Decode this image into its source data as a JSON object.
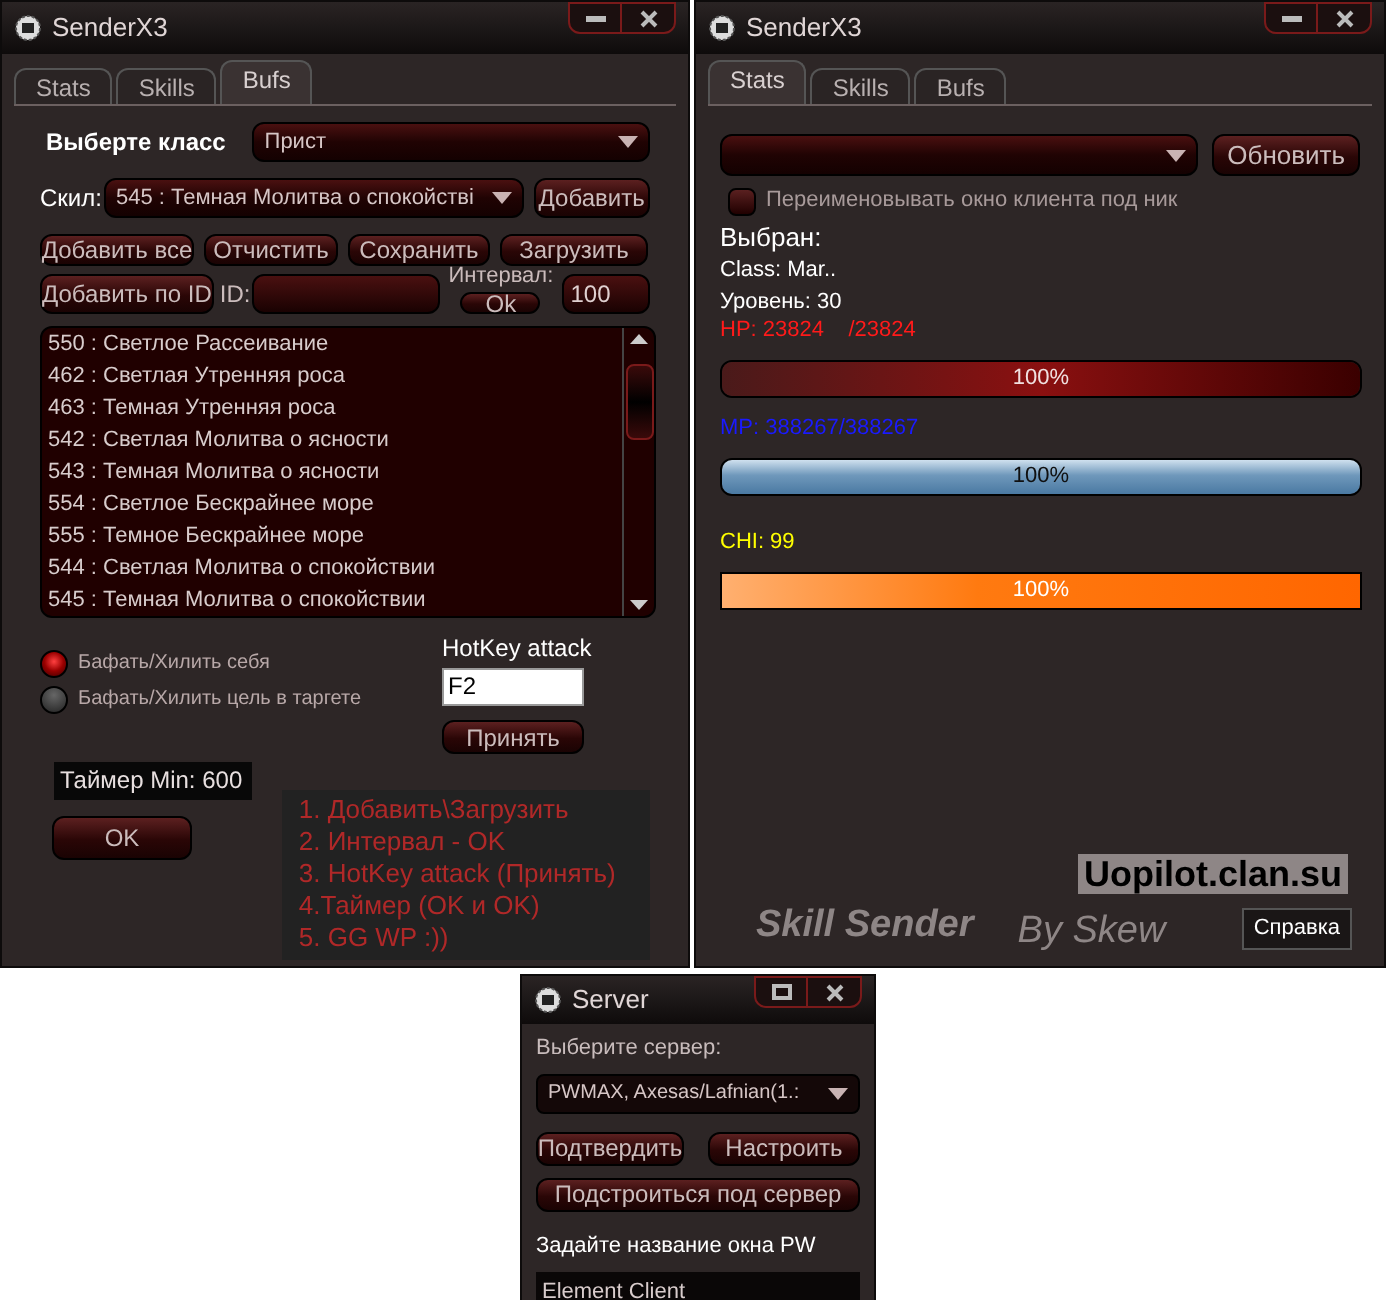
{
  "bufs_window": {
    "title": "SenderX3",
    "tabs": [
      {
        "label": "Stats",
        "selected": false
      },
      {
        "label": "Skills",
        "selected": false
      },
      {
        "label": "Bufs",
        "selected": true
      }
    ],
    "class_label": "Выберте класс",
    "class_value": "Прист",
    "skill_label": "Скил:",
    "skill_value": "545 : Темная Молитва о спокойстві",
    "add_button": "Добавить",
    "action_buttons": [
      "Добавить все",
      "Отчистить",
      "Сохранить",
      "Загрузить"
    ],
    "add_by_id_button": "Добавить по ID",
    "id_label": "ID:",
    "interval_label": "Интервал:",
    "interval_ok": "Ok",
    "interval_value": "100",
    "skills": [
      "550 : Светлое Рассеивание",
      "462 : Светлая Утренняя роса",
      "463 : Темная Утренняя роса",
      "542 : Светлая Молитва о ясности",
      "543 : Темная Молитва о ясности",
      "554 : Светлое Бескрайнее море",
      "555 : Темное Бескрайнее море",
      "544 : Светлая Молитва о спокойствии",
      "545 : Темная Молитва о спокойствии"
    ],
    "targets": [
      {
        "label": "Бафать/Хилить себя",
        "selected": true
      },
      {
        "label": "Бафать/Хилить цель в таргете",
        "selected": false
      }
    ],
    "hotkey_label": "HotKey attack",
    "hotkey_value": "F2",
    "apply_button": "Принять",
    "timer_value": "Таймер Min: 600",
    "ok_button": "OK",
    "instructions": [
      "1. Добавить\\Загрузить",
      "2. Интервал - OK",
      "3. HotKey attack (Принять)",
      "4.Таймер (OK и OK)",
      "5. GG WP :))"
    ]
  },
  "stats_window": {
    "title": "SenderX3",
    "tabs": [
      {
        "label": "Stats",
        "selected": true
      },
      {
        "label": "Skills",
        "selected": false
      },
      {
        "label": "Bufs",
        "selected": false
      }
    ],
    "refresh_button": "Обновить",
    "rename_option": {
      "label": "Переименовывать окно клиента под ник",
      "checked": false
    },
    "selected_label": "Выбран:",
    "class_text": "Class: Mar..",
    "level_text": "Уровень: 30",
    "meters": [
      {
        "kind": "hp",
        "label": "HP: 23824    /23824",
        "level": 1,
        "reading": "100%"
      },
      {
        "kind": "mp",
        "label": "MP: 388267/388267",
        "level": 1,
        "reading": "100%"
      },
      {
        "kind": "chi",
        "label": "CHI: 99",
        "level": 1,
        "reading": "100%"
      }
    ],
    "site": "Uopilot.clan.su",
    "app_name": "Skill Sender",
    "author": "By Skew",
    "help_button": "Справка"
  },
  "server_window": {
    "title": "Server",
    "server_label": "Выберите сервер:",
    "server_value": "PWMAX, Axesas/Lafnian(1.:",
    "confirm_button": "Подтвердить",
    "setup_button": "Настроить",
    "adapt_button": "Подстроиться под сервер",
    "window_name_label": "Задайте название окна PW",
    "window_name_value": "Element Client"
  }
}
